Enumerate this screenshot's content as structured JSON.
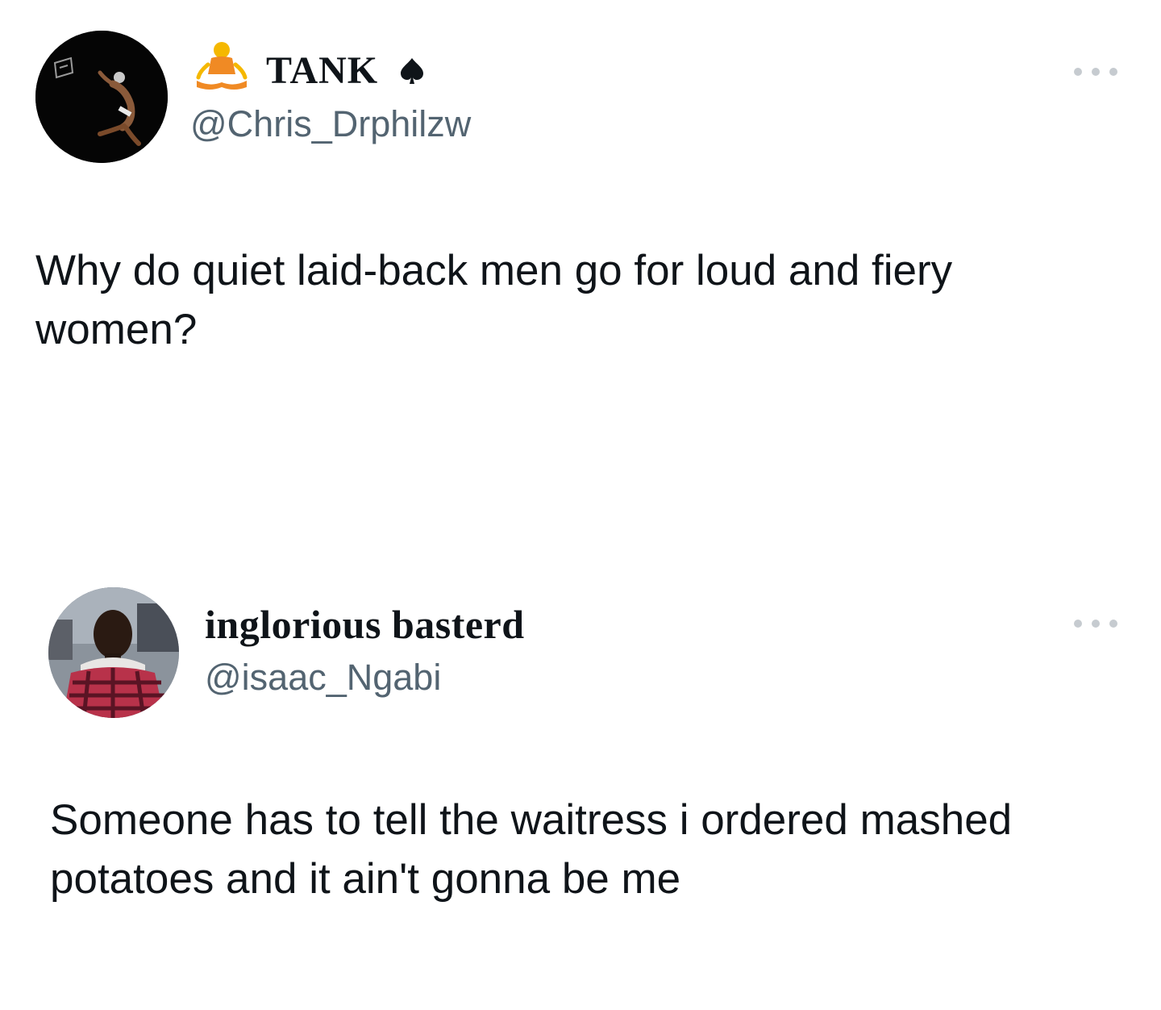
{
  "tweets": [
    {
      "display_name": "TANK",
      "name_emoji_icon": "person-in-lotus-position-icon",
      "name_suffix_icon": "spade-icon",
      "handle": "@Chris_Drphilzw",
      "text": "Why do quiet laid-back men go for loud and fiery women?",
      "menu_icon": "more-options-icon"
    },
    {
      "display_name": "inglorious basterd",
      "handle": "@isaac_Ngabi",
      "text": "Someone has to tell the waitress i ordered mashed potatoes and it ain't gonna be me",
      "menu_icon": "more-options-icon"
    }
  ],
  "colors": {
    "background": "#ffffff",
    "text": "#0f1419",
    "handle": "#536471",
    "menu_dots": "#c6cbd0",
    "emoji_body": "#f5b800",
    "emoji_clothing": "#f08a24"
  }
}
